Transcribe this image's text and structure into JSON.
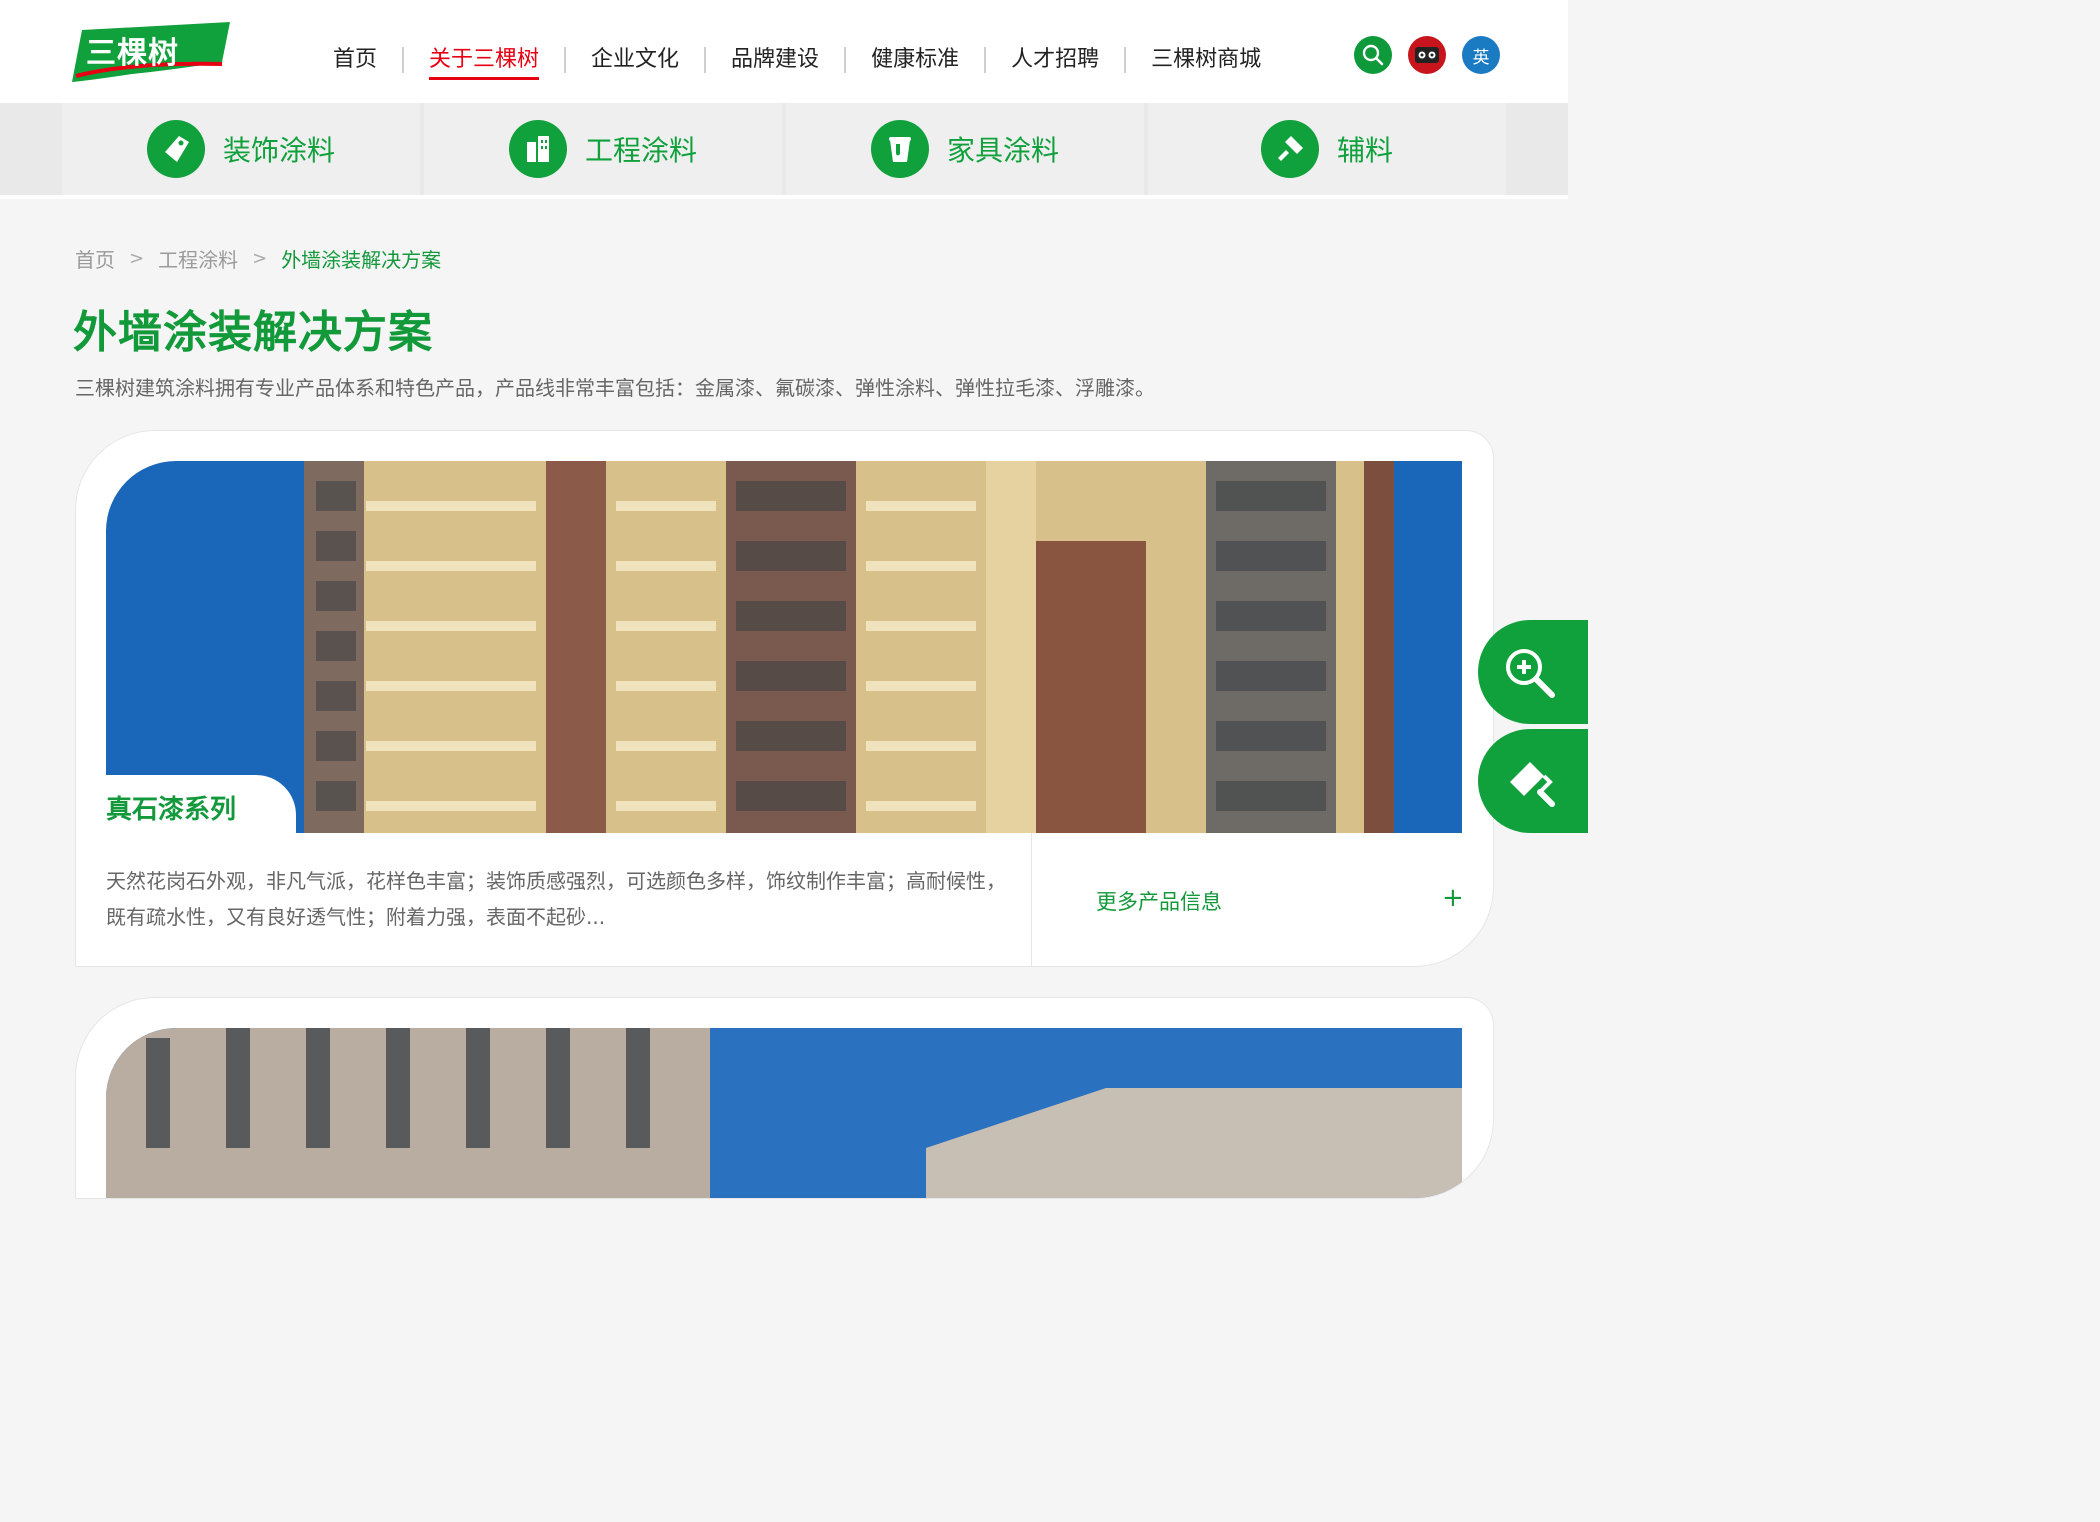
{
  "brand": {
    "logo_text": "三棵树",
    "primary_color": "#10a03c",
    "accent_color": "#e60012"
  },
  "nav": {
    "items": [
      {
        "label": "首页",
        "active": false
      },
      {
        "label": "关于三棵树",
        "active": true
      },
      {
        "label": "企业文化",
        "active": false
      },
      {
        "label": "品牌建设",
        "active": false
      },
      {
        "label": "健康标准",
        "active": false
      },
      {
        "label": "人才招聘",
        "active": false
      },
      {
        "label": "三棵树商城",
        "active": false
      }
    ],
    "icons": [
      "search-icon",
      "tmall-icon"
    ],
    "lang_label": "英"
  },
  "categories": [
    {
      "label": "装饰涂料",
      "icon": "brush-tag-icon"
    },
    {
      "label": "工程涂料",
      "icon": "building-icon"
    },
    {
      "label": "家具涂料",
      "icon": "paint-bucket-icon"
    },
    {
      "label": "辅料",
      "icon": "tool-icon"
    }
  ],
  "breadcrumb": {
    "home": "首页",
    "level1": "工程涂料",
    "current": "外墙涂装解决方案",
    "separator": ">"
  },
  "page": {
    "title": "外墙涂装解决方案",
    "description": "三棵树建筑涂料拥有专业产品体系和特色产品，产品线非常丰富包括：金属漆、氟碳漆、弹性涂料、弹性拉毛漆、浮雕漆。"
  },
  "cards": [
    {
      "series": "真石漆系列",
      "description": "天然花岗石外观，非凡气派，花样色丰富；装饰质感强烈，可选颜色多样，饰纹制作丰富；高耐候性，既有疏水性，又有良好透气性；附着力强，表面不起砂...",
      "more_label": "更多产品信息",
      "more_symbol": "+"
    }
  ],
  "side_buttons": [
    "zoom-in-icon",
    "paint-roller-icon"
  ]
}
